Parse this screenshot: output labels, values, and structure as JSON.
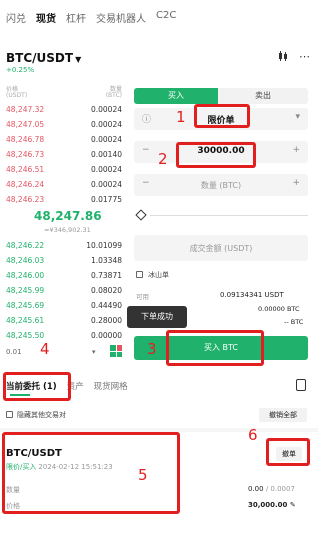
{
  "top_tabs": [
    "闪兑",
    "现货",
    "杠杆",
    "交易机器人",
    "C2C"
  ],
  "pair": {
    "name": "BTC/USDT",
    "change": "+0.25%"
  },
  "icons": {
    "candle": "candlestick-icon",
    "more": "more-icon"
  },
  "orderbook": {
    "header_price": "价格",
    "header_price_unit": "(USDT)",
    "header_qty": "数量",
    "header_qty_unit": "(BTC)",
    "asks": [
      {
        "price": "48,247.32",
        "qty": "0.00024"
      },
      {
        "price": "48,247.05",
        "qty": "0.00024"
      },
      {
        "price": "48,246.78",
        "qty": "0.00024"
      },
      {
        "price": "48,246.73",
        "qty": "0.00140"
      },
      {
        "price": "48,246.51",
        "qty": "0.00024"
      },
      {
        "price": "48,246.24",
        "qty": "0.00024"
      },
      {
        "price": "48,246.23",
        "qty": "0.01775"
      }
    ],
    "last_price": "48,247.86",
    "last_price_sub": "≈¥346,902.31",
    "bids": [
      {
        "price": "48,246.22",
        "qty": "10.01099"
      },
      {
        "price": "48,246.03",
        "qty": "1.03348"
      },
      {
        "price": "48,246.00",
        "qty": "0.73871"
      },
      {
        "price": "48,245.99",
        "qty": "0.08020"
      },
      {
        "price": "48,245.69",
        "qty": "0.44490"
      },
      {
        "price": "48,245.61",
        "qty": "0.28000"
      },
      {
        "price": "48,245.50",
        "qty": "0.00000"
      }
    ],
    "depth": "0.01"
  },
  "trade_panel": {
    "buy_tab": "买入",
    "sell_tab": "卖出",
    "order_type": "限价单",
    "price_value": "30000.00",
    "amount_placeholder": "数量 (BTC)",
    "total_placeholder": "成交金额 (USDT)",
    "iceberg_label": "冰山单",
    "available_label": "可用",
    "available_usdt": "0.09134341 USDT",
    "available_btc": "0.00000 BTC",
    "available_extra": "-- BTC",
    "buy_button": "买入 BTC",
    "toast": "下单成功"
  },
  "bottom_tabs": {
    "orders": "当前委托 (1)",
    "assets": "资产",
    "grid": "现货网格"
  },
  "orders_bar": {
    "hide_others": "隐藏其他交易对",
    "cancel_all": "撤销全部"
  },
  "order": {
    "pair": "BTC/USDT",
    "side": "限价/买入",
    "time": "2024-02-12 15:51:23",
    "cancel": "撤单",
    "qty_label": "数量",
    "qty_value": "0.00",
    "qty_total": " / 0.0007",
    "price_label": "价格",
    "price_value": "30,000.00"
  },
  "annotations": [
    "1",
    "2",
    "3",
    "4",
    "5",
    "6"
  ],
  "colors": {
    "green": "#20b26c",
    "red": "#e45563",
    "annotation": "#e21f1f"
  }
}
